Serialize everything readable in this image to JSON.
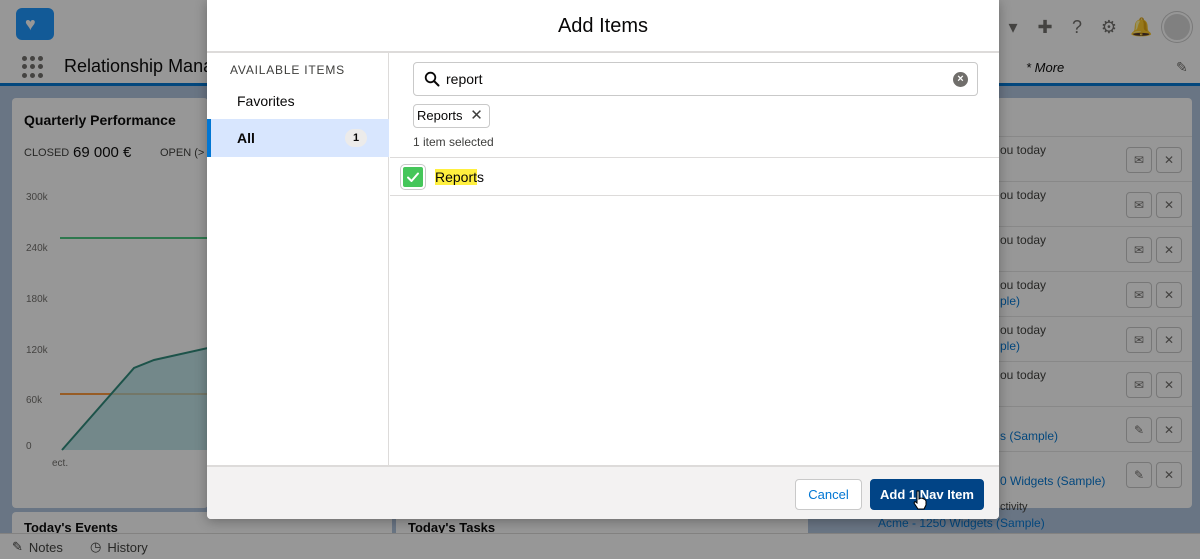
{
  "app": {
    "name": "Relationship Mana",
    "more_label": "* More",
    "colors": {
      "brand": "#0176d3",
      "primary_button": "#014486",
      "success": "#45c65a",
      "highlight": "#fff03f"
    }
  },
  "background": {
    "quarterly": {
      "title": "Quarterly Performance",
      "closed_label": "CLOSED",
      "closed_value": "69 000 €",
      "open_label": "OPEN (>",
      "y_ticks": [
        "300k",
        "240k",
        "180k",
        "120k",
        "60k",
        "0"
      ],
      "x_tick": "ect."
    },
    "activity_rows": [
      {
        "text": "ou today",
        "link": ""
      },
      {
        "text": "ou today",
        "link": ""
      },
      {
        "text": "ou today",
        "link": ""
      },
      {
        "text": "ou today",
        "link": "ple)"
      },
      {
        "text": "ou today",
        "link": "ple)"
      },
      {
        "text": "ou today",
        "link": ""
      },
      {
        "text": "",
        "link": "s (Sample)"
      },
      {
        "text": "",
        "link": "0 Widgets (Sample)"
      }
    ],
    "bottom": {
      "events_title": "Today's Events",
      "tasks_title": "Today's Tasks",
      "activity_label": "ctivity",
      "acme_link": "Acme - 1250 Widgets (Sample)"
    },
    "utility": {
      "notes": "Notes",
      "history": "History"
    }
  },
  "modal": {
    "title": "Add Items",
    "left": {
      "section_label": "AVAILABLE ITEMS",
      "items": [
        {
          "label": "Favorites",
          "count": ""
        },
        {
          "label": "All",
          "count": "1"
        }
      ]
    },
    "search": {
      "value": "report",
      "placeholder": ""
    },
    "selected_pill": "Reports",
    "selected_count_text": "1 item selected",
    "results": [
      {
        "highlight": "Report",
        "rest": "s",
        "checked": true
      }
    ],
    "footer": {
      "cancel_label": "Cancel",
      "add_label": "Add 1 Nav Item"
    }
  }
}
